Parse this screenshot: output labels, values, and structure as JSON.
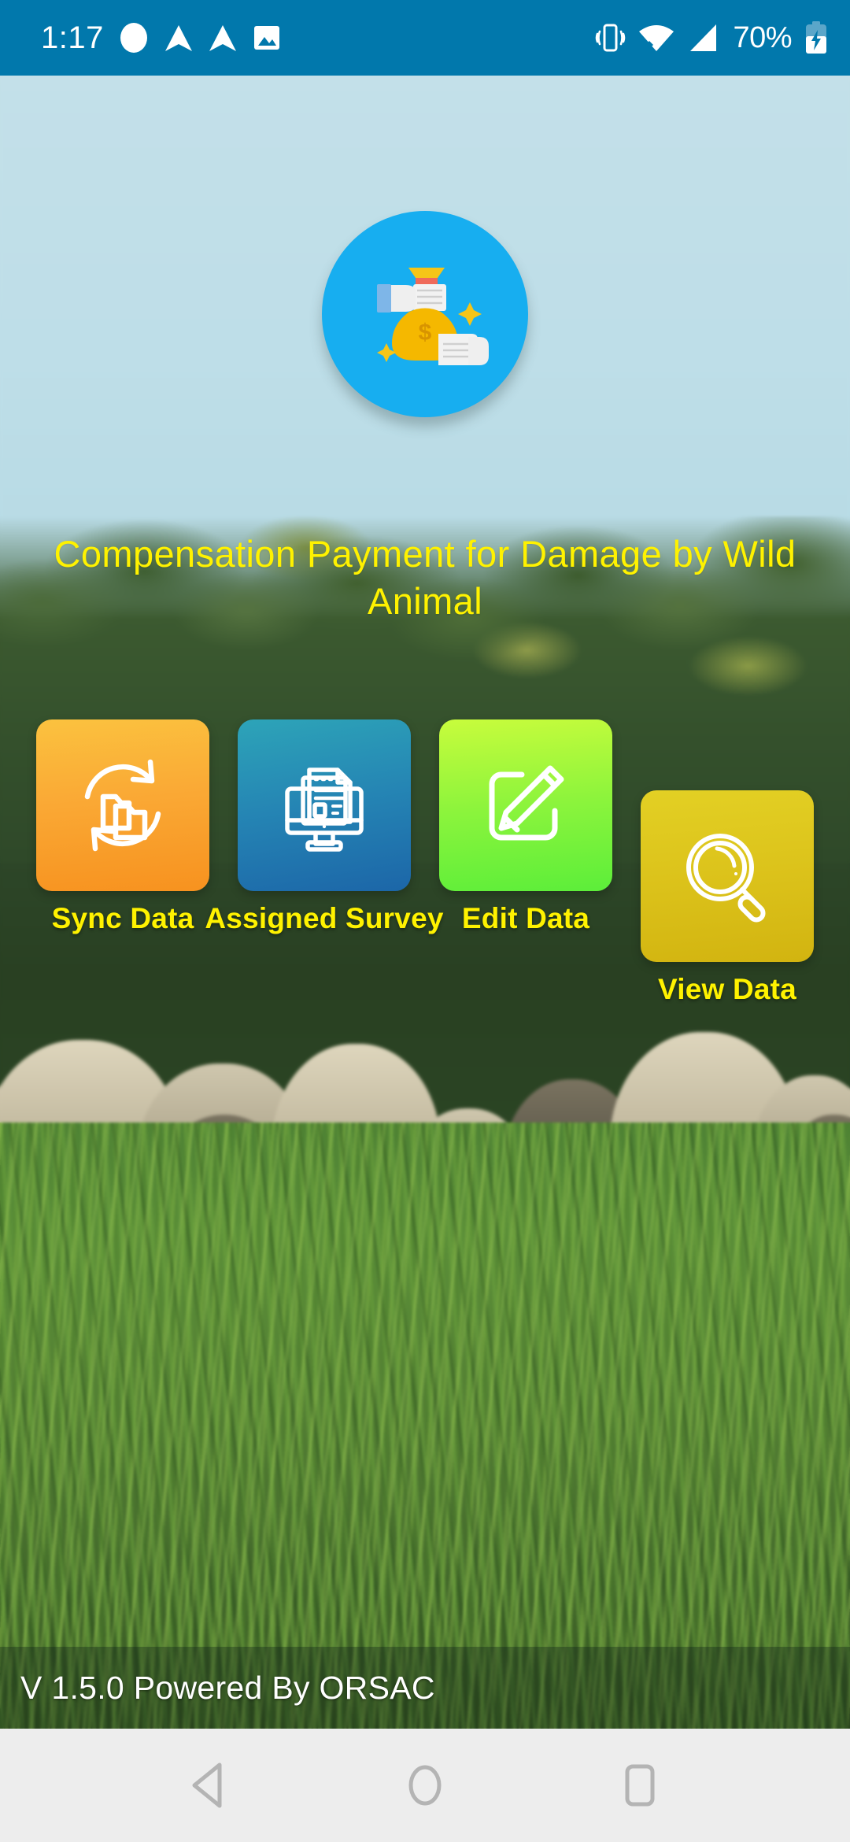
{
  "status_bar": {
    "clock": "1:17",
    "battery_percent": "70%",
    "background_color": "#0178AC",
    "icons": [
      "circle-notification-icon",
      "navigation-arrow-icon",
      "navigation-arrow-icon",
      "image-notification-icon",
      "vibrate-icon",
      "wifi-icon",
      "cellular-signal-icon",
      "battery-charging-icon"
    ]
  },
  "app": {
    "logo_icon": "money-exchange-hands-icon",
    "logo_background_color": "#17AEF0",
    "title": "Compensation Payment for Damage by Wild Animal",
    "title_color": "#FFF200"
  },
  "tiles": [
    {
      "label": "Sync Data",
      "icon": "sync-folders-icon",
      "color_start": "#FBC23F",
      "color_end": "#F7921F"
    },
    {
      "label": "Assigned Survey",
      "icon": "monitor-document-icon",
      "color_start": "#2DA4B8",
      "color_end": "#1C66A8"
    },
    {
      "label": "Edit Data",
      "icon": "pencil-edit-square-icon",
      "color_start": "#C8FC3C",
      "color_end": "#5CEE3A"
    },
    {
      "label": "View Data",
      "icon": "magnifying-glass-icon",
      "color_start": "#E3D024",
      "color_end": "#D2B410"
    }
  ],
  "footer": {
    "text": "V 1.5.0 Powered By ORSAC"
  },
  "nav_bar": {
    "background_color": "#EDEDED",
    "buttons": [
      {
        "name": "back-button",
        "icon": "triangle-back-icon"
      },
      {
        "name": "home-button",
        "icon": "circle-home-icon"
      },
      {
        "name": "recents-button",
        "icon": "square-recents-icon"
      }
    ]
  }
}
